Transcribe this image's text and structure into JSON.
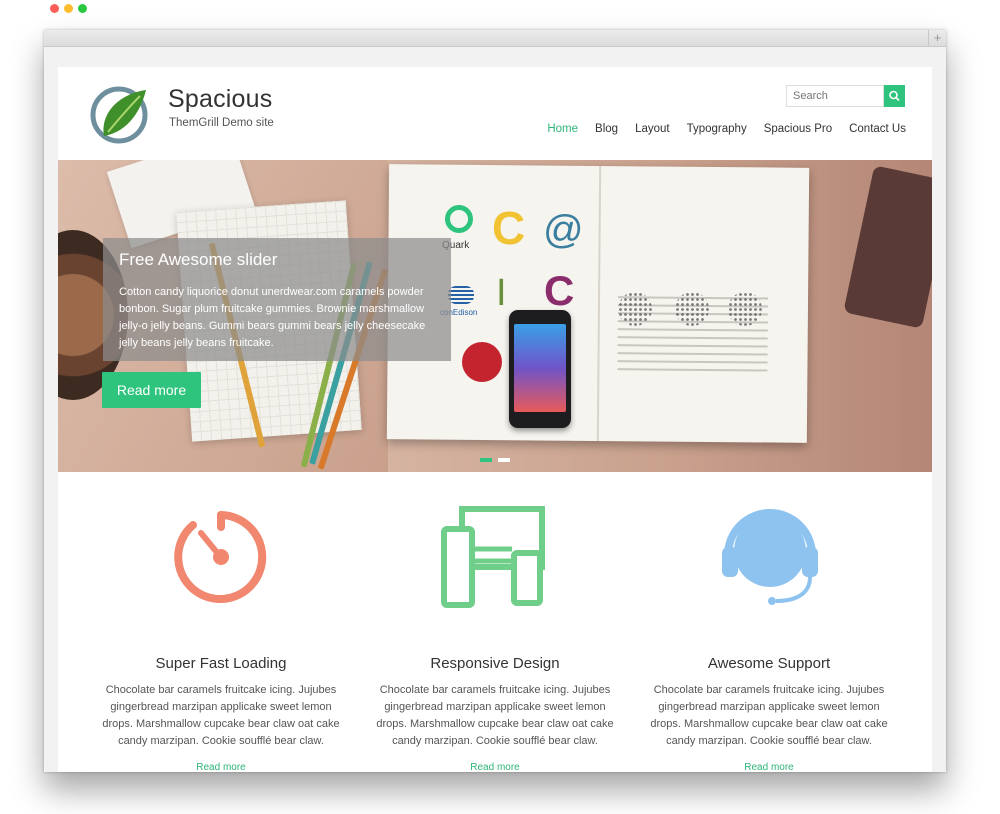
{
  "browser": {
    "newtab_symbol": "+"
  },
  "header": {
    "site_title": "Spacious",
    "site_description": "ThemGrill Demo site",
    "search_placeholder": "Search",
    "nav": [
      "Home",
      "Blog",
      "Layout",
      "Typography",
      "Spacious Pro",
      "Contact Us"
    ],
    "active_nav": "Home"
  },
  "slider": {
    "title": "Free Awesome slider",
    "text": "Cotton candy liquorice donut unerdwear.com caramels powder bonbon. Sugar plum fruitcake gummies. Brownie marshmallow jelly-o jelly beans. Gummi bears gummi bears jelly cheesecake jelly beans jelly beans fruitcake.",
    "button_label": "Read more",
    "logo_labels": {
      "quark": "Quark",
      "conedison": "conEdison"
    },
    "slide_count": 2,
    "active_slide": 1
  },
  "features": [
    {
      "title": "Super Fast Loading",
      "icon": "stopwatch-icon",
      "color": "#f0876e",
      "text": "Chocolate bar caramels fruitcake icing. Jujubes gingerbread marzipan applicake sweet lemon drops. Marshmallow cupcake bear claw oat cake candy marzipan. Cookie soufflé bear claw.",
      "link": "Read more"
    },
    {
      "title": "Responsive Design",
      "icon": "devices-icon",
      "color": "#6fcf8a",
      "text": "Chocolate bar caramels fruitcake icing. Jujubes gingerbread marzipan applicake sweet lemon drops. Marshmallow cupcake bear claw oat cake candy marzipan. Cookie soufflé bear claw.",
      "link": "Read more"
    },
    {
      "title": "Awesome Support",
      "icon": "headset-icon",
      "color": "#8ec3f0",
      "text": "Chocolate bar caramels fruitcake icing. Jujubes gingerbread marzipan applicake sweet lemon drops. Marshmallow cupcake bear claw oat cake candy marzipan. Cookie soufflé bear claw.",
      "link": "Read more"
    }
  ],
  "colors": {
    "accent": "#2ec47d",
    "nav_active": "#2fb578"
  }
}
